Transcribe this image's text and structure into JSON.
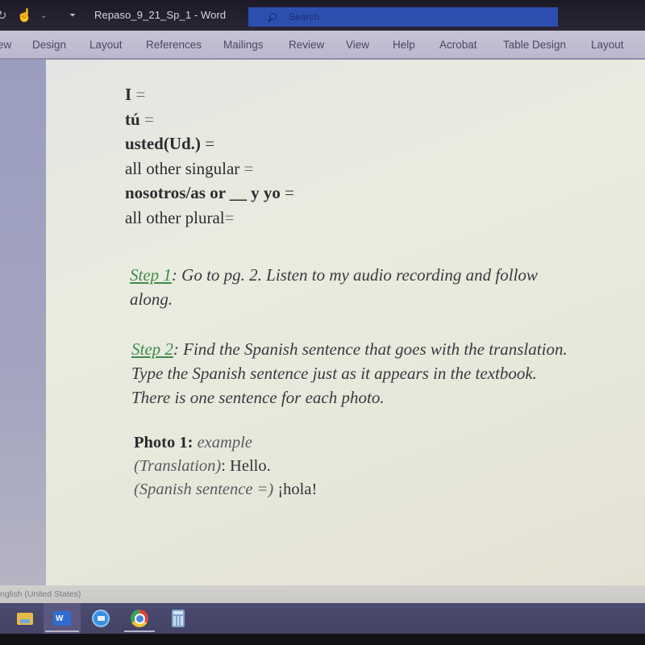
{
  "titlebar": {
    "document_title": "Repaso_9_21_Sp_1",
    "separator": " - ",
    "app_name": "Word",
    "search": {
      "placeholder": "Search",
      "value": ""
    },
    "quick_access": [
      {
        "icon": "redo-icon"
      },
      {
        "icon": "touch-mode-icon"
      },
      {
        "icon": "chevron-down-icon"
      },
      {
        "icon": "customize-qat-icon"
      }
    ]
  },
  "ribbon": {
    "tabs": [
      {
        "label": "ew",
        "full_label": "View (Review, partially visible)"
      },
      {
        "label": "Design"
      },
      {
        "label": "Layout"
      },
      {
        "label": "References"
      },
      {
        "label": "Mailings"
      },
      {
        "label": "Review"
      },
      {
        "label": "View"
      },
      {
        "label": "Help"
      },
      {
        "label": "Acrobat"
      },
      {
        "label": "Table Design"
      },
      {
        "label": "Layout"
      }
    ]
  },
  "document": {
    "pronouns": [
      {
        "term": "I",
        "eq": " =",
        "bold": true
      },
      {
        "term": "tú",
        "eq": " =",
        "bold": true
      },
      {
        "term": "usted(Ud.)",
        "eq": " =",
        "bold": true
      },
      {
        "term": "all other singular",
        "eq": " =",
        "bold": false
      },
      {
        "term": "nosotros/as or __ y yo",
        "eq": " =",
        "bold": true
      },
      {
        "term": "all other plural",
        "eq": "=",
        "bold": false
      }
    ],
    "step1": {
      "link": "Step 1",
      "text_line1": ": Go to pg. 2. Listen to my audio recording and follow",
      "text_line2": "along."
    },
    "step2": {
      "link": "Step 2",
      "text_line1": ": Find the Spanish sentence that goes with the translation.",
      "text_line2": "Type the Spanish sentence just as it appears in the textbook.",
      "text_line3": "There is one sentence for each photo."
    },
    "photo1": {
      "label": "Photo 1:",
      "label_suffix": " example",
      "translation_label": "(Translation)",
      "translation_value": ": Hello.",
      "spanish_label": "(Spanish sentence =)",
      "spanish_value": " ¡hola!"
    }
  },
  "statusbar": {
    "language": "nglish (United States)"
  },
  "taskbar": {
    "apps": [
      {
        "name": "File Explorer",
        "icon": "folder-icon",
        "active": false
      },
      {
        "name": "Word",
        "icon": "word-icon",
        "icon_letter": "W",
        "active": true
      },
      {
        "name": "Zoom",
        "icon": "zoom-icon",
        "active": false
      },
      {
        "name": "Chrome",
        "icon": "chrome-icon",
        "active": false
      },
      {
        "name": "Calculator",
        "icon": "calculator-icon",
        "active": false
      }
    ]
  },
  "colors": {
    "search_box": "#2c4fb0",
    "step_link": "#3e8a4b",
    "ribbon_bg": "#c2bfd3",
    "taskbar_bg": "#48476b"
  }
}
